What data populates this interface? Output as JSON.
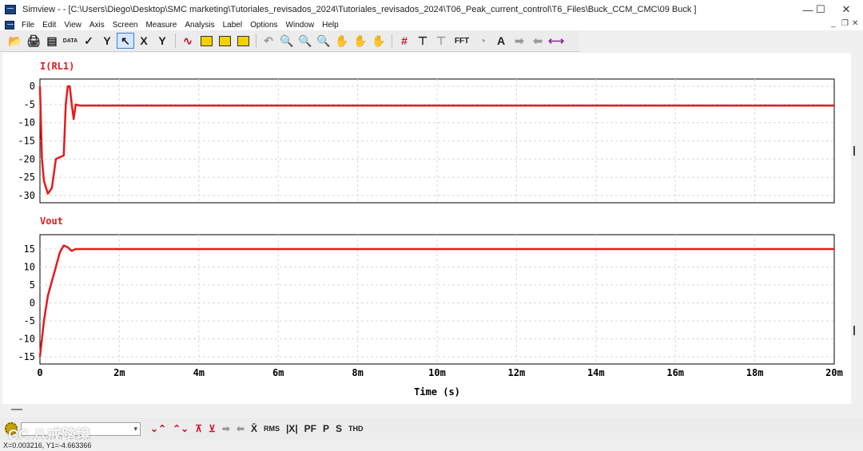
{
  "window": {
    "title": "Simview - - [C:\\Users\\Diego\\Desktop\\SMC marketing\\Tutoriales_revisados_2024\\Tutoriales_revisados_2024\\T06_Peak_current_control\\T6_Files\\Buck_CCM_CMC\\09 Buck ]",
    "minimize": "—",
    "maximize": "☐",
    "close": "✕"
  },
  "menu": [
    "File",
    "Edit",
    "View",
    "Axis",
    "Screen",
    "Measure",
    "Analysis",
    "Label",
    "Options",
    "Window",
    "Help"
  ],
  "mdi_controls": {
    "min": "_",
    "restore": "❐",
    "close": "✕"
  },
  "toolbar": {
    "data_label": "DATA",
    "x_label": "X",
    "y_label": "Y",
    "fft_label": "FFT",
    "text_label": "A"
  },
  "bottom_toolbar": {
    "combo_value": "▾",
    "mean_label": "X̄",
    "rms_label": "RMS",
    "abs_label": "|X|",
    "pf_label": "PF",
    "p_label": "P",
    "s_label": "S",
    "thd_label": "THD"
  },
  "status": {
    "readout": "X=0.003216, Y1=-4.663366"
  },
  "watermark": "CC 八戒踏境",
  "colors": {
    "trace": "#e8191c",
    "accent": "#3b7bd6"
  },
  "chart_data": [
    {
      "type": "line",
      "title": "I(RL1)",
      "x_unit": "s",
      "xlim": [
        0,
        0.02
      ],
      "ylim": [
        -32,
        2
      ],
      "yticks": [
        0,
        -5,
        -10,
        -15,
        -20,
        -25,
        -30
      ],
      "grid": true,
      "series": [
        {
          "name": "I(RL1)",
          "x": [
            0,
            5e-05,
            0.0001,
            0.0002,
            0.0003,
            0.0004,
            0.0005,
            0.0006,
            0.00065,
            0.0007,
            0.00075,
            0.0008,
            0.00085,
            0.0009,
            0.001,
            0.0015,
            0.002,
            0.005,
            0.01,
            0.015,
            0.02
          ],
          "y": [
            0,
            -20,
            -26,
            -29.5,
            -28,
            -20,
            -19.5,
            -19,
            -5,
            0,
            0,
            -5,
            -9,
            -5,
            -5.3,
            -5.3,
            -5.3,
            -5.3,
            -5.3,
            -5.3,
            -5.3
          ]
        }
      ]
    },
    {
      "type": "line",
      "title": "Vout",
      "xlabel": "Time (s)",
      "x_unit": "s",
      "xlim": [
        0,
        0.02
      ],
      "ylim": [
        -17,
        19
      ],
      "yticks": [
        15,
        10,
        5,
        0,
        -5,
        -10,
        -15
      ],
      "xticks": [
        0,
        0.002,
        0.004,
        0.006,
        0.008,
        0.01,
        0.012,
        0.014,
        0.016,
        0.018,
        0.02
      ],
      "xtick_labels": [
        "0",
        "2m",
        "4m",
        "6m",
        "8m",
        "10m",
        "12m",
        "14m",
        "16m",
        "18m",
        "20m"
      ],
      "grid": true,
      "series": [
        {
          "name": "Vout",
          "x": [
            0,
            5e-05,
            0.0001,
            0.0002,
            0.0003,
            0.0004,
            0.0005,
            0.0006,
            0.0007,
            0.0008,
            0.0009,
            0.001,
            0.002,
            0.005,
            0.01,
            0.015,
            0.02
          ],
          "y": [
            -15,
            -10,
            -5,
            2,
            6,
            10,
            14,
            16,
            15.5,
            14.5,
            15,
            15,
            15,
            15,
            15,
            15,
            15
          ]
        }
      ]
    }
  ]
}
